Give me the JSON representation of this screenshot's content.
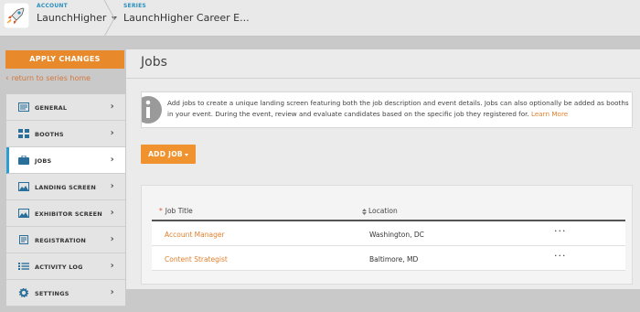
{
  "header": {
    "account_label": "ACCOUNT",
    "account_name": "LaunchHigher",
    "series_label": "SERIES",
    "series_name": "LaunchHigher Career E..."
  },
  "sidebar": {
    "apply_label": "APPLY CHANGES",
    "return_label": "return to series home",
    "items": [
      {
        "label": "GENERAL",
        "icon": "general-icon"
      },
      {
        "label": "BOOTHS",
        "icon": "booths-icon"
      },
      {
        "label": "JOBS",
        "icon": "briefcase-icon",
        "active": true
      },
      {
        "label": "LANDING SCREEN",
        "icon": "image-icon"
      },
      {
        "label": "EXHIBITOR SCREEN",
        "icon": "exhibitor-screen-icon"
      },
      {
        "label": "REGISTRATION",
        "icon": "registration-icon"
      },
      {
        "label": "ACTIVITY LOG",
        "icon": "list-icon"
      },
      {
        "label": "SETTINGS",
        "icon": "gear-icon"
      }
    ]
  },
  "main": {
    "title": "Jobs",
    "info_text": "Add jobs to create a unique landing screen featuring both the job description and event details. Jobs can also optionally be added as booths in your event. During the event, review and evaluate candidates based on the specific job they registered for.",
    "learn_more": "Learn More",
    "add_job_label": "ADD JOB",
    "table": {
      "columns": [
        "Job Title",
        "Location"
      ],
      "rows": [
        {
          "title": "Account Manager",
          "location": "Washington, DC",
          "more": "···"
        },
        {
          "title": "Content Strategist",
          "location": "Baltimore, MD",
          "more": "···"
        }
      ]
    }
  },
  "colors": {
    "accent_orange": "#f0922e",
    "link_orange": "#e07f2c",
    "active_blue": "#2a9dd1"
  }
}
